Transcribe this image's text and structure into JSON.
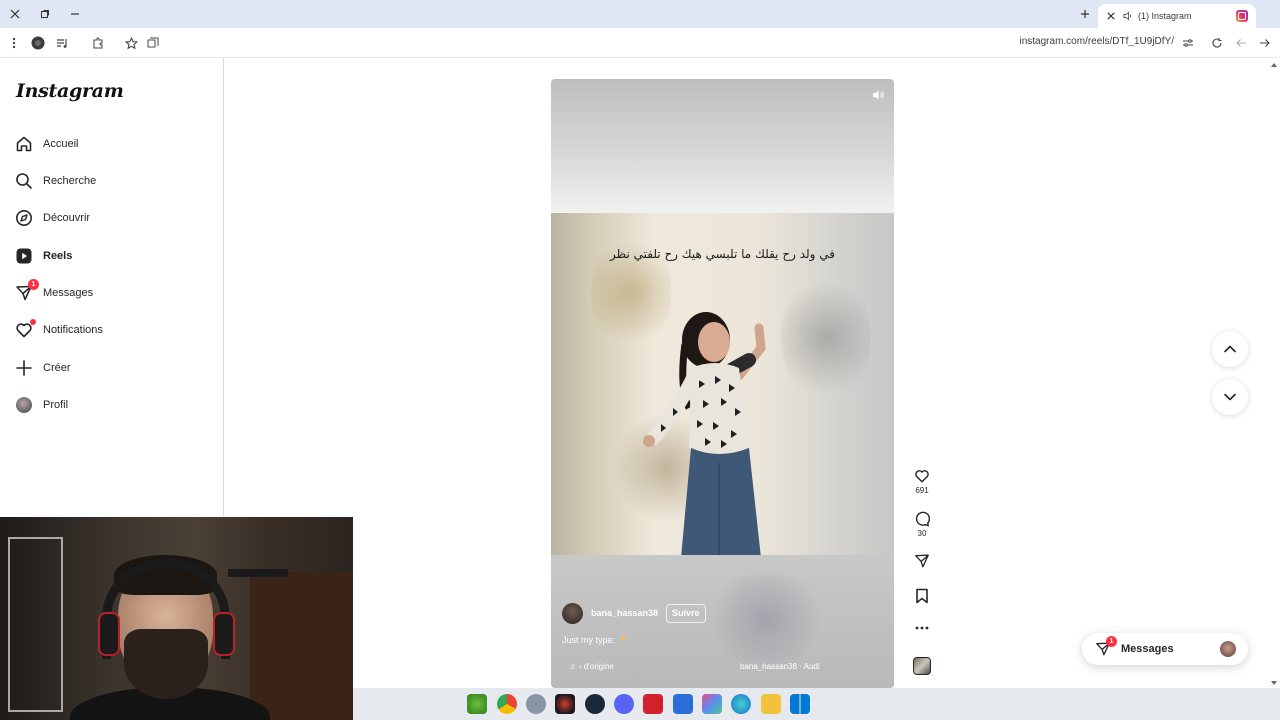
{
  "browser": {
    "tab_title": "(1) Instagram",
    "url": "instagram.com/reels/DTf_1U9jDfY/",
    "icons": [
      "close-icon",
      "restore-icon",
      "minimize-icon",
      "new-tab-icon",
      "menu-icon",
      "profile-icon",
      "reading-list-icon",
      "extensions-icon",
      "bookmark-star-icon",
      "collections-icon",
      "site-settings-icon",
      "reload-icon",
      "back-icon",
      "forward-icon"
    ]
  },
  "sidebar": {
    "logo": "Instagram",
    "items": [
      {
        "label": "Accueil",
        "icon": "home-icon"
      },
      {
        "label": "Recherche",
        "icon": "search-icon"
      },
      {
        "label": "Découvrir",
        "icon": "compass-icon"
      },
      {
        "label": "Reels",
        "icon": "reels-icon",
        "active": true
      },
      {
        "label": "Messages",
        "icon": "messenger-icon",
        "badge": "1"
      },
      {
        "label": "Notifications",
        "icon": "heart-icon",
        "dot": true
      },
      {
        "label": "Créer",
        "icon": "plus-icon"
      },
      {
        "label": "Profil",
        "icon": "avatar"
      }
    ]
  },
  "reel": {
    "overlay_text": "في ولد رح يقلك ما تلبسي هيك رح تلفتي نظر",
    "author": "bana_hassan38",
    "follow_label": "Suivre",
    "caption": "Just my type:",
    "audio_left": "› d'origine",
    "audio_right": "bana_hassan38 · Audi",
    "likes": "691",
    "comments": "30"
  },
  "messages_pill": {
    "label": "Messages",
    "badge": "1"
  },
  "colors": {
    "accent_red": "#ff3040",
    "titlebar": "#dfe6f4",
    "taskbar": "#e6e9ee",
    "text": "#262626"
  }
}
